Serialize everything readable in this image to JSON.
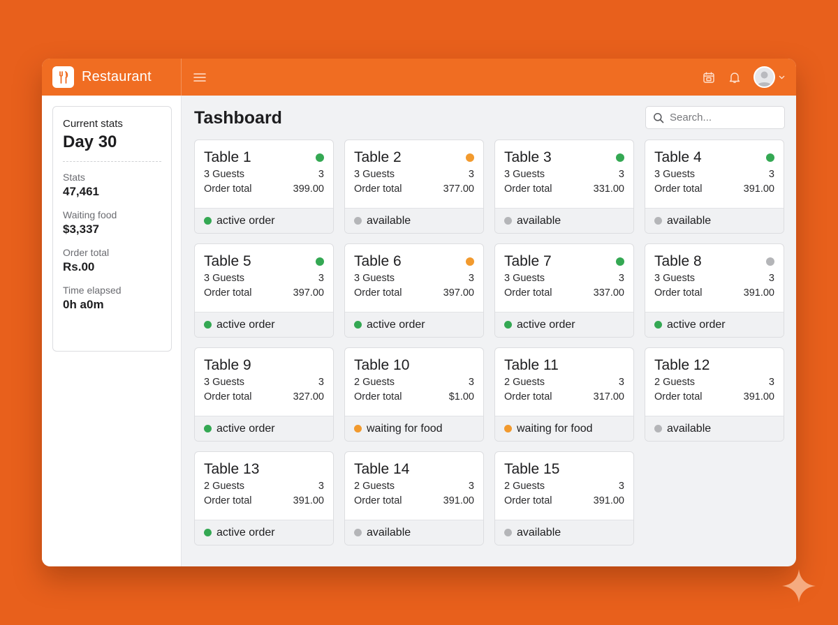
{
  "app": {
    "name": "Restaurant"
  },
  "colors": {
    "brand": "#f06d22",
    "background": "#e8601c",
    "status_green": "#34a853",
    "status_orange": "#f29a2e",
    "status_gray": "#b4b5b8"
  },
  "icons": {
    "logo": "fork-knife-icon",
    "menu": "hamburger-icon",
    "calendar": "calendar-icon",
    "notifications": "bell-icon",
    "account": "avatar",
    "search": "search-icon"
  },
  "sidebar": {
    "heading": "Current stats",
    "day": "Day 30",
    "stats": [
      {
        "label": "Stats",
        "value": "47,461"
      },
      {
        "label": "Waiting food",
        "value": "$3,337"
      },
      {
        "label": "Order total",
        "value": "Rs.00"
      },
      {
        "label": "Time elapsed",
        "value": "0h a0m"
      }
    ]
  },
  "main": {
    "title": "Tashboard",
    "search_placeholder": "Search..."
  },
  "tables": [
    {
      "name": "Table 1",
      "indicator": "green",
      "guests_label": "3 Guests",
      "guests_count": "3",
      "total_label": "Order total",
      "total": "399.00",
      "status": "active order",
      "status_color": "green"
    },
    {
      "name": "Table 2",
      "indicator": "orange",
      "guests_label": "3 Guests",
      "guests_count": "3",
      "total_label": "Order total",
      "total": "377.00",
      "status": "available",
      "status_color": "gray"
    },
    {
      "name": "Table 3",
      "indicator": "green",
      "guests_label": "3 Guests",
      "guests_count": "3",
      "total_label": "Order total",
      "total": "331.00",
      "status": "available",
      "status_color": "gray"
    },
    {
      "name": "Table 4",
      "indicator": "green",
      "guests_label": "3 Guests",
      "guests_count": "3",
      "total_label": "Order total",
      "total": "391.00",
      "status": "available",
      "status_color": "gray"
    },
    {
      "name": "Table 5",
      "indicator": "green",
      "guests_label": "3 Guests",
      "guests_count": "3",
      "total_label": "Order total",
      "total": "397.00",
      "status": "active order",
      "status_color": "green"
    },
    {
      "name": "Table 6",
      "indicator": "orange",
      "guests_label": "3 Guests",
      "guests_count": "3",
      "total_label": "Order total",
      "total": "397.00",
      "status": "active order",
      "status_color": "green"
    },
    {
      "name": "Table 7",
      "indicator": "green",
      "guests_label": "3 Guests",
      "guests_count": "3",
      "total_label": "Order total",
      "total": "337.00",
      "status": "active order",
      "status_color": "green"
    },
    {
      "name": "Table 8",
      "indicator": "gray",
      "guests_label": "3 Guests",
      "guests_count": "3",
      "total_label": "Order total",
      "total": "391.00",
      "status": "active order",
      "status_color": "green"
    },
    {
      "name": "Table 9",
      "indicator": "none",
      "guests_label": "3 Guests",
      "guests_count": "3",
      "total_label": "Order total",
      "total": "327.00",
      "status": "active order",
      "status_color": "green"
    },
    {
      "name": "Table 10",
      "indicator": "none",
      "guests_label": "2 Guests",
      "guests_count": "3",
      "total_label": "Order total",
      "total": "$1.00",
      "status": "waiting for food",
      "status_color": "orange"
    },
    {
      "name": "Table 11",
      "indicator": "none",
      "guests_label": "2 Guests",
      "guests_count": "3",
      "total_label": "Order total",
      "total": "317.00",
      "status": "waiting for food",
      "status_color": "orange"
    },
    {
      "name": "Table 12",
      "indicator": "none",
      "guests_label": "2 Guests",
      "guests_count": "3",
      "total_label": "Order total",
      "total": "391.00",
      "status": "available",
      "status_color": "gray"
    },
    {
      "name": "Table 13",
      "indicator": "none",
      "guests_label": "2 Guests",
      "guests_count": "3",
      "total_label": "Order total",
      "total": "391.00",
      "status": "active order",
      "status_color": "green"
    },
    {
      "name": "Table 14",
      "indicator": "none",
      "guests_label": "2 Guests",
      "guests_count": "3",
      "total_label": "Order total",
      "total": "391.00",
      "status": "available",
      "status_color": "gray"
    },
    {
      "name": "Table 15",
      "indicator": "none",
      "guests_label": "2 Guests",
      "guests_count": "3",
      "total_label": "Order total",
      "total": "391.00",
      "status": "available",
      "status_color": "gray"
    }
  ]
}
